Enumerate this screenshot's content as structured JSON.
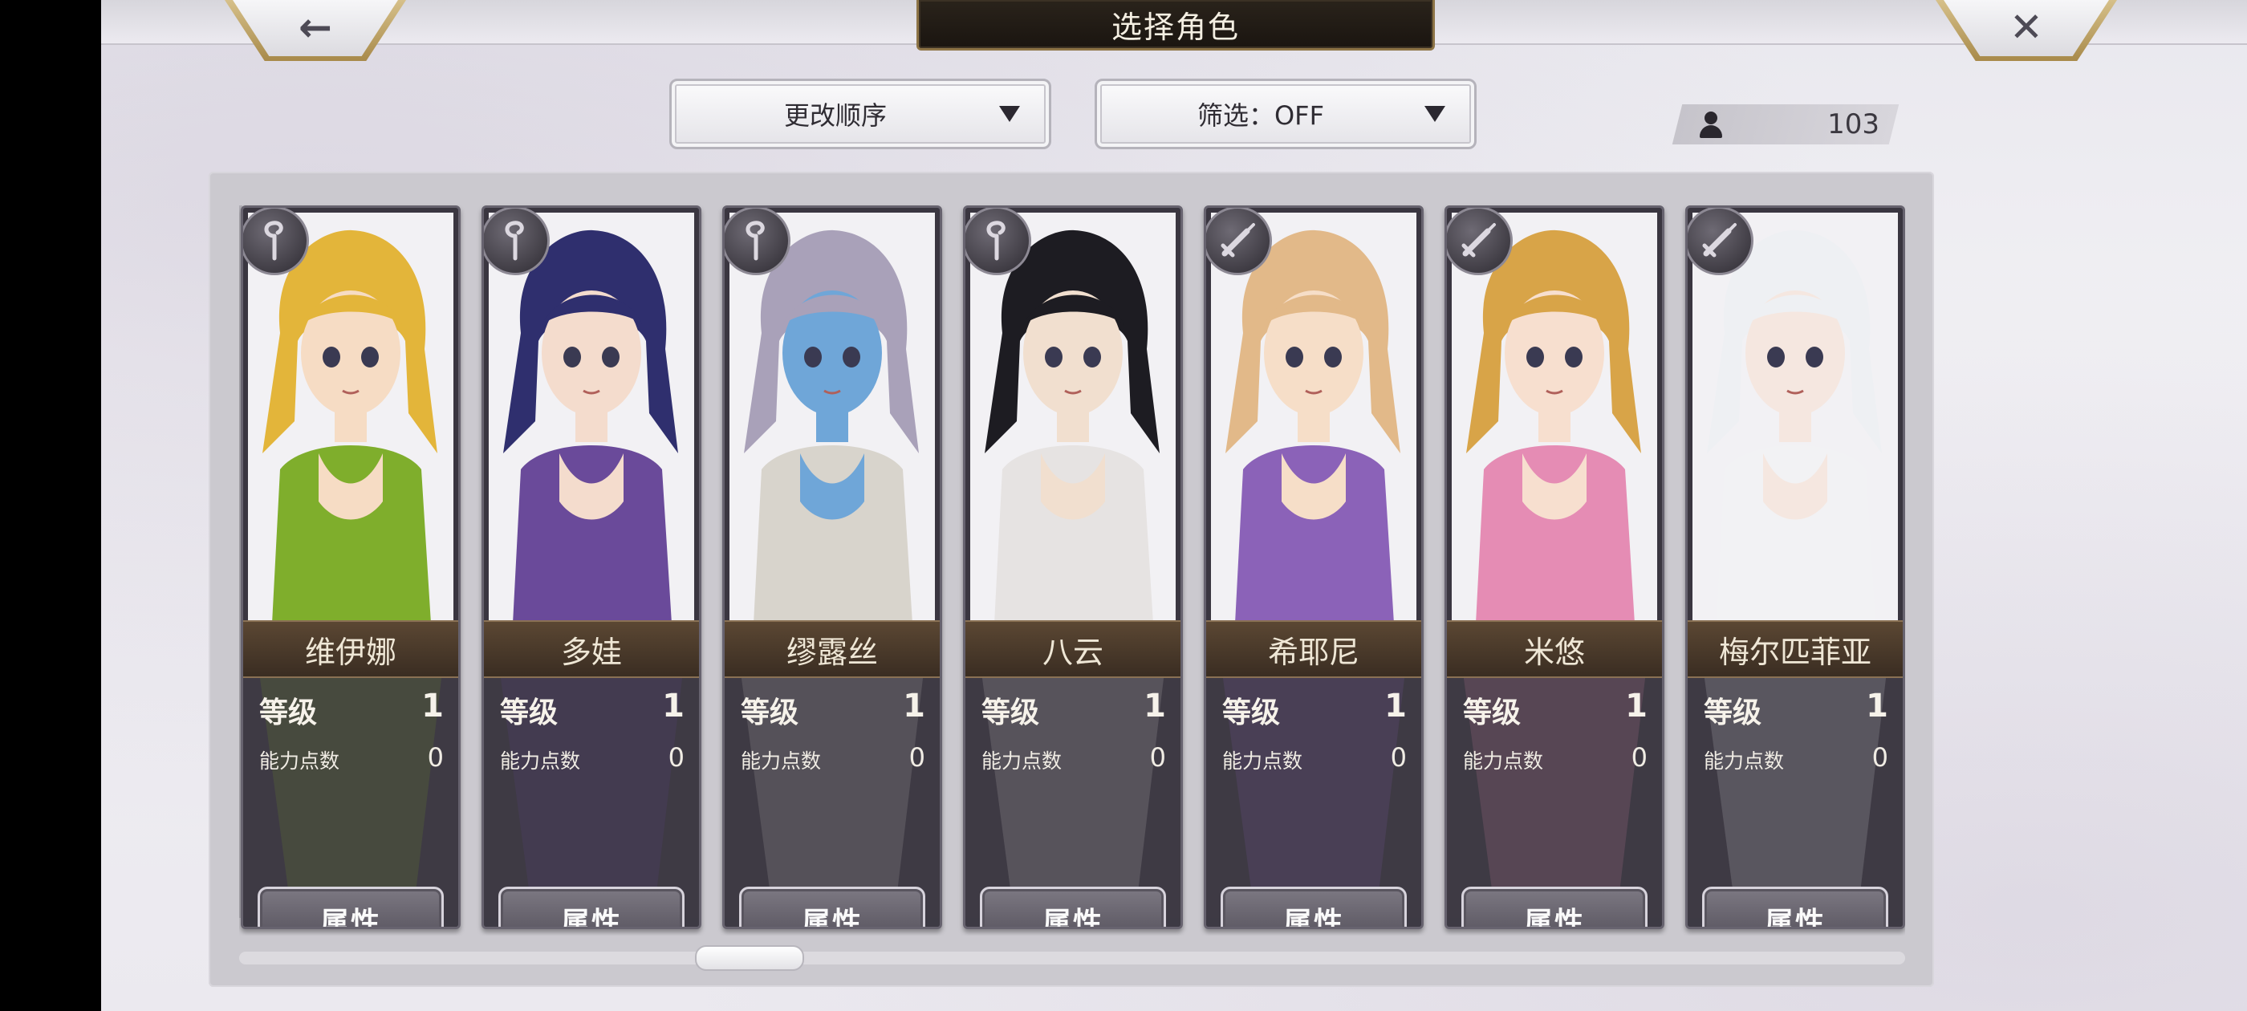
{
  "header": {
    "title": "选择角色",
    "back_icon": "←",
    "close_icon": "✕"
  },
  "controls": {
    "sort_label": "更改顺序",
    "filter_label": "筛选：OFF",
    "character_count": "103"
  },
  "card_labels": {
    "level": "等级",
    "ability_points": "能力点数",
    "attributes_button": "属性"
  },
  "characters": [
    {
      "name": "维伊娜",
      "level": "1",
      "ability_points": "0",
      "class_icon": "staff-icon",
      "hair": "#e3b53a",
      "skin": "#f6dcc4",
      "outfit": "#7fae2c"
    },
    {
      "name": "多娃",
      "level": "1",
      "ability_points": "0",
      "class_icon": "staff-icon",
      "hair": "#2f2f6e",
      "skin": "#f4dccd",
      "outfit": "#6a4a9a"
    },
    {
      "name": "缪露丝",
      "level": "1",
      "ability_points": "0",
      "class_icon": "staff-icon",
      "hair": "#a9a1b9",
      "skin": "#6fa6d8",
      "outfit": "#d8d4cc"
    },
    {
      "name": "八云",
      "level": "1",
      "ability_points": "0",
      "class_icon": "staff-icon",
      "hair": "#1d1c22",
      "skin": "#f1dfcf",
      "outfit": "#e6e3e2"
    },
    {
      "name": "希耶尼",
      "level": "1",
      "ability_points": "0",
      "class_icon": "sword-icon",
      "hair": "#e2b989",
      "skin": "#f6dec8",
      "outfit": "#8b62b8"
    },
    {
      "name": "米悠",
      "level": "1",
      "ability_points": "0",
      "class_icon": "sword-icon",
      "hair": "#d8a448",
      "skin": "#f7dfcf",
      "outfit": "#e58cb4"
    },
    {
      "name": "梅尔匹菲亚",
      "level": "1",
      "ability_points": "0",
      "class_icon": "sword-icon",
      "hair": "#eef0f3",
      "skin": "#f5e7e0",
      "outfit": "#f2f2f4"
    }
  ]
}
